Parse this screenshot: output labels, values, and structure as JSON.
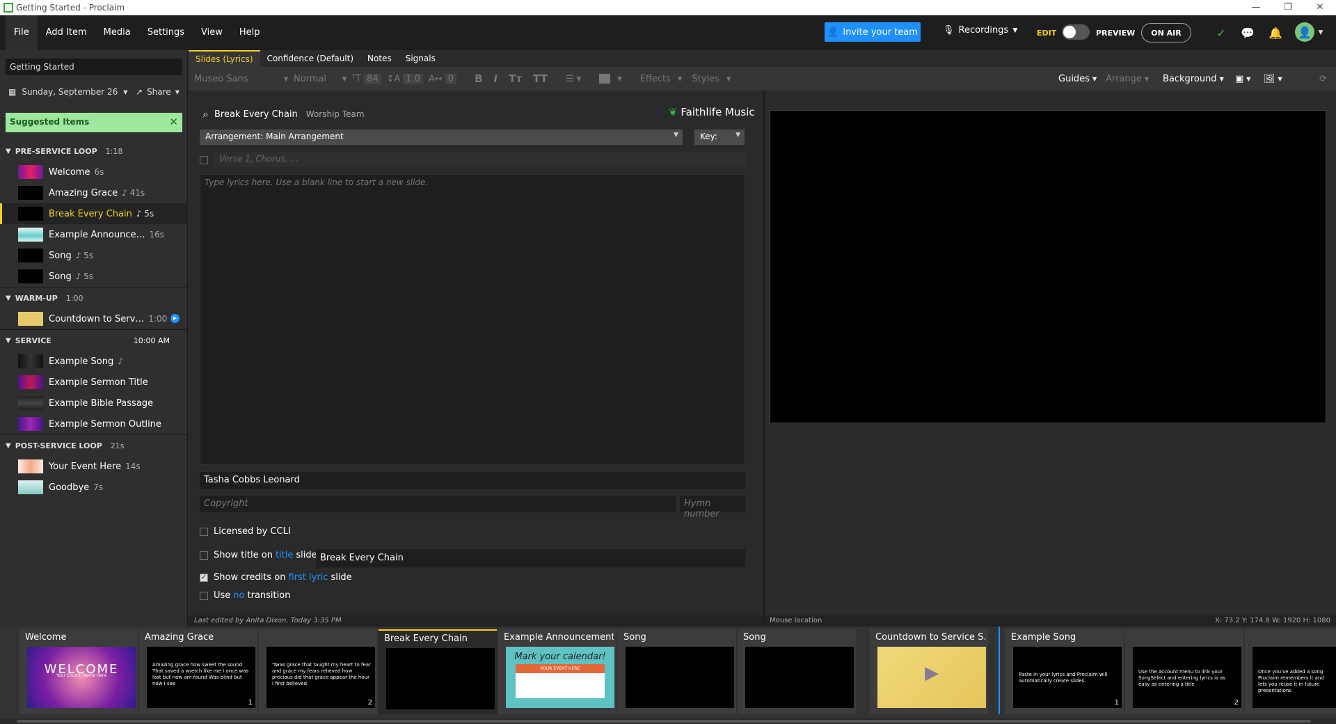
{
  "window": {
    "title": "Getting Started - Proclaim",
    "controls": [
      "—",
      "❐",
      "✕"
    ]
  },
  "menu": {
    "items": [
      "File",
      "Add Item",
      "Media",
      "Settings",
      "View",
      "Help"
    ]
  },
  "header": {
    "invite_label": "Invite your team",
    "recordings_label": "Recordings",
    "edit_label": "EDIT",
    "preview_label": "PREVIEW",
    "onair_label": "ON AIR"
  },
  "sidebar": {
    "presentation_title": "Getting Started",
    "date": "Sunday, September 26",
    "share_label": "Share",
    "suggested_label": "Suggested Items",
    "sections": [
      {
        "name": "Pre-Service Loop",
        "duration": "1:18"
      },
      {
        "name": "Warm-Up",
        "duration": "1:00"
      },
      {
        "name": "Service",
        "duration": "10:00 AM"
      },
      {
        "name": "Post-Service Loop",
        "duration": "21s"
      }
    ],
    "items": [
      {
        "label": "Welcome",
        "duration": "6s"
      },
      {
        "label": "Amazing Grace",
        "duration": "♪ 41s"
      },
      {
        "label": "Break Every Chain",
        "duration": "♪ 5s"
      },
      {
        "label": "Example Announce…",
        "duration": "16s"
      },
      {
        "label": "Song",
        "duration": "♪ 5s"
      },
      {
        "label": "Song",
        "duration": "♪ 5s"
      },
      {
        "label": "Countdown to Serv…",
        "duration": "1:00"
      },
      {
        "label": "Example Song",
        "duration": "♪"
      },
      {
        "label": "Example Sermon Title",
        "duration": ""
      },
      {
        "label": "Example Bible Passage",
        "duration": ""
      },
      {
        "label": "Example Sermon Outline",
        "duration": ""
      },
      {
        "label": "Your Event Here",
        "duration": "14s"
      },
      {
        "label": "Goodbye",
        "duration": "7s"
      }
    ]
  },
  "tabs": [
    "Slides (Lyrics)",
    "Confidence (Default)",
    "Notes",
    "Signals"
  ],
  "toolbar": {
    "font": "Museo Sans",
    "weight": "Normal",
    "size": "84",
    "line_height": "1.0",
    "spacing": "0",
    "effects": "Effects",
    "styles": "Styles",
    "guides": "Guides",
    "arrange": "Arrange",
    "background": "Background"
  },
  "editor": {
    "song_title": "Break Every Chain",
    "team": "Worship Team",
    "brand": "Faithlife Music",
    "arrangement": "Arrangement: Main Arrangement",
    "key_label": "Key:",
    "verse_placeholder": "Verse 1, Chorus, ...",
    "lyrics_placeholder": "Type lyrics here. Use a blank line to start a new slide.",
    "author": "Tasha Cobbs Leonard",
    "copyright_placeholder": "Copyright",
    "hymn_placeholder": "Hymn number",
    "licensed_label": "Licensed by CCLI",
    "show_title_pre": "Show title on",
    "show_title_link": "title",
    "show_title_post": "slide",
    "title_value": "Break Every Chain",
    "show_credits_pre": "Show credits on",
    "show_credits_link": "first lyric",
    "show_credits_post": "slide",
    "use_pre": "Use",
    "use_link": "no",
    "use_post": "transition",
    "last_edited": "Last edited by Anita Dixon, Today 3:35 PM"
  },
  "preview": {
    "mouse_label": "Mouse location",
    "coords": "X: 73.2  Y: 174.8   W: 1920  H: 1080"
  },
  "strip": {
    "cards": [
      {
        "label": "Welcome",
        "text": "",
        "num": ""
      },
      {
        "label": "Amazing Grace",
        "text": "Amazing grace how sweet the sound That saved a wretch like me I once was lost but now am found Was blind but now I see",
        "num": "1"
      },
      {
        "label": "",
        "text": "'Twas grace that taught my heart to fear and grace my fears relieved how precious did that grace appear the hour I first believed",
        "num": "2"
      },
      {
        "label": "Break Every Chain",
        "text": "",
        "num": ""
      },
      {
        "label": "Example Announcement",
        "text": "",
        "num": ""
      },
      {
        "label": "Song",
        "text": "",
        "num": ""
      },
      {
        "label": "Song",
        "text": "",
        "num": ""
      },
      {
        "label": "Countdown to Service S…",
        "text": "",
        "num": ""
      },
      {
        "label": "Example Song",
        "text": "Paste in your lyrics and Proclaim will automatically create slides.",
        "num": "1"
      },
      {
        "label": "",
        "text": "Use the account menu to link your SongSelect and entering lyrics is as easy as entering a title",
        "num": "2"
      },
      {
        "label": "",
        "text": "Once you've added a song Proclaim remembers it and lets you reuse it in future presentations",
        "num": ""
      }
    ],
    "welcome_text": "WELCOME",
    "welcome_sub": "Your Church Name Here",
    "announce_title": "Mark your calendar!",
    "announce_banner": "YOUR EVENT HERE"
  }
}
